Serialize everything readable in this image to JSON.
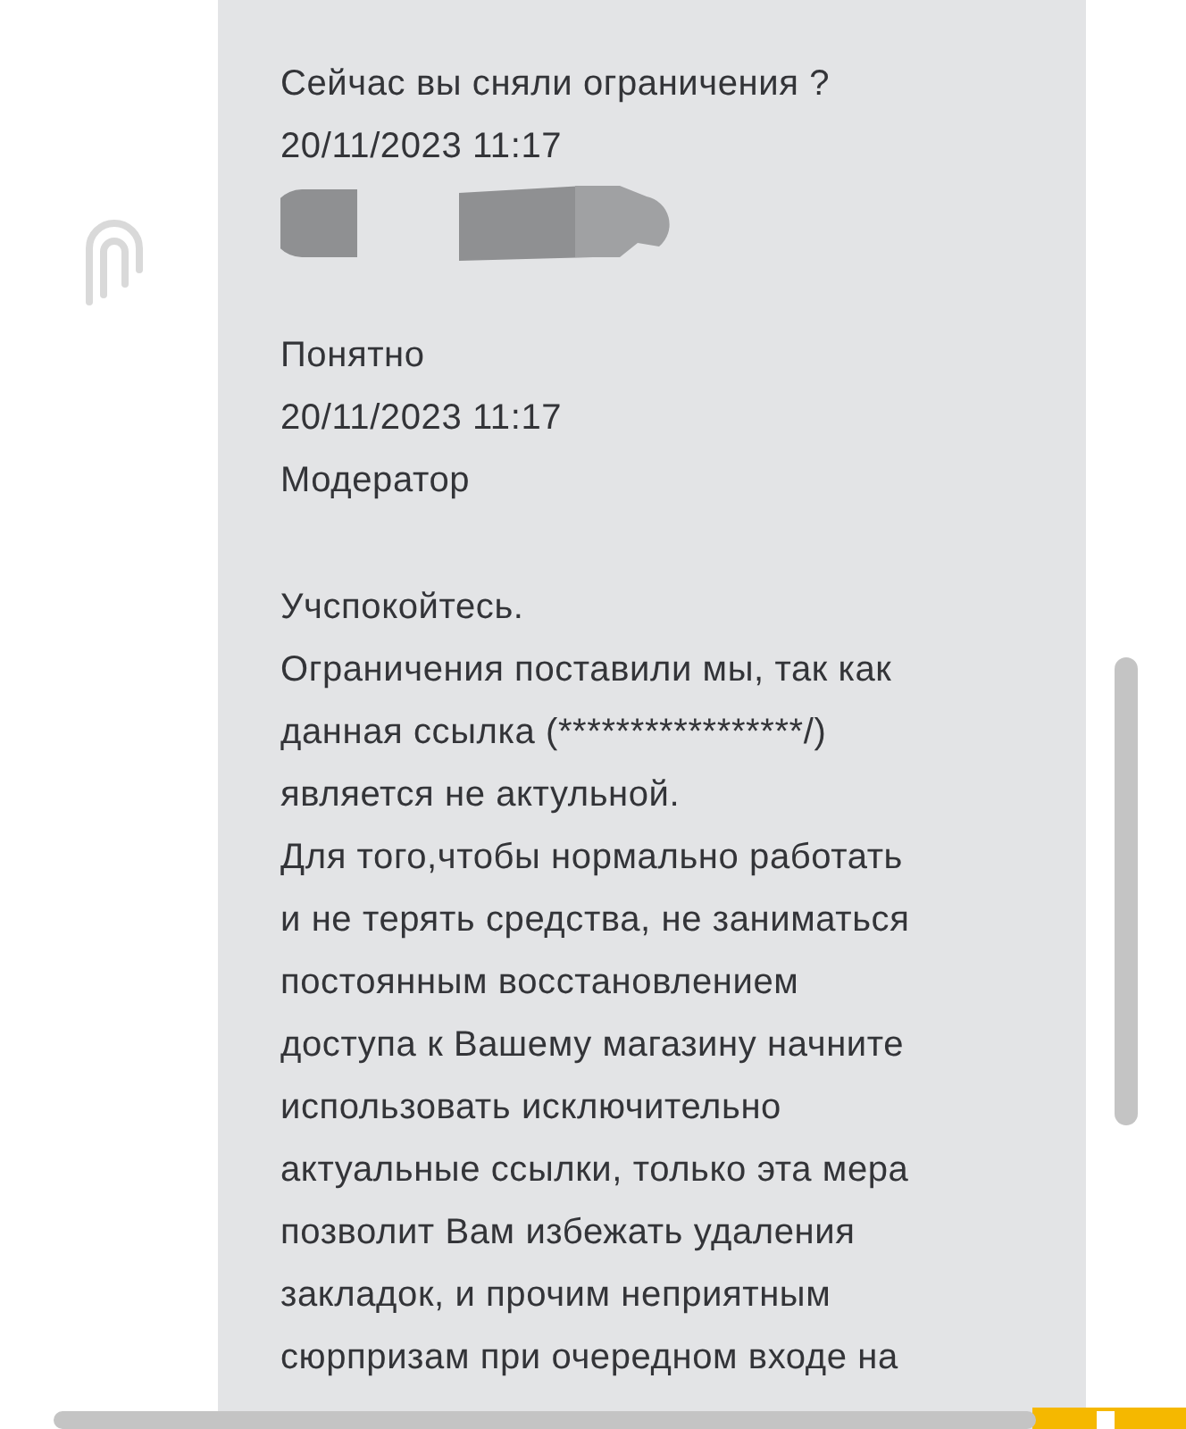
{
  "messages": [
    {
      "paragraphs": [
        {
          "lines": [
            "Сейчас вы сняли ограничения ?"
          ]
        },
        {
          "lines": [
            "20/11/2023 11:17"
          ]
        }
      ],
      "redacted_author": true
    },
    {
      "paragraphs": [
        {
          "lines": [
            "Понятно"
          ]
        },
        {
          "lines": [
            "20/11/2023 11:17"
          ]
        },
        {
          "lines": [
            "Модератор"
          ]
        }
      ],
      "redacted_author": false
    },
    {
      "paragraphs": [
        {
          "lines": [
            "Учспокойтесь."
          ]
        },
        {
          "lines": [
            "Ограничения поставили мы, так как",
            "данная ссылка (*****************/)",
            "является не актульной."
          ]
        },
        {
          "lines": [
            "Для того,чтобы нормально работать",
            "и не терять средства, не заниматься",
            "постоянным восстановлением",
            "доступа к Вашему магазину начните",
            "использовать исключительно",
            "актуальные ссылки, только эта мера",
            "позволит Вам избежать удаления",
            "закладок, и прочим неприятным",
            "сюрпризам при очередном входе на"
          ]
        }
      ],
      "redacted_author": false
    }
  ]
}
